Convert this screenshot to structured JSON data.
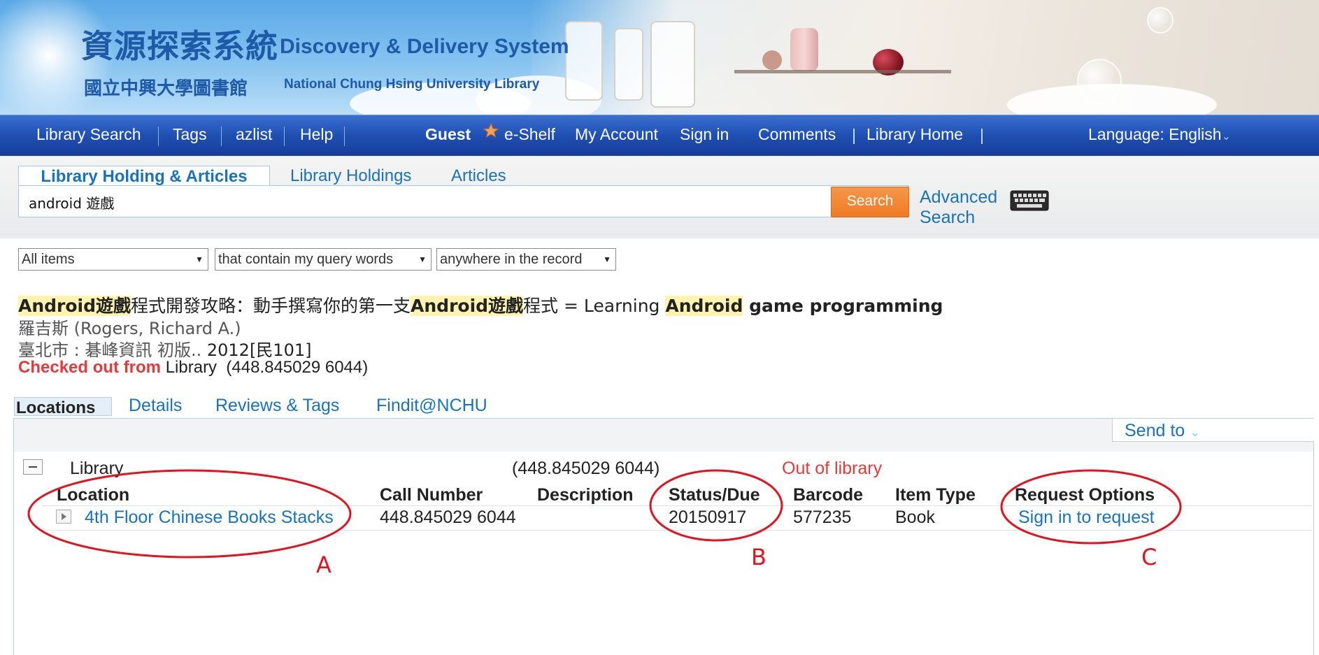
{
  "banner": {
    "title_zh": "資源探索系統",
    "title_en": "Discovery & Delivery System",
    "org_zh": "國立中興大學圖書館",
    "org_en": "National Chung Hsing University Library"
  },
  "nav": {
    "left": [
      "Library Search",
      "Tags",
      "azlist",
      "Help"
    ],
    "guest": "Guest",
    "eshelf": "e-Shelf",
    "my_account": "My Account",
    "sign_in": "Sign in",
    "comments": "Comments",
    "library_home": "Library Home",
    "language": "Language: English",
    "separator": "|"
  },
  "search": {
    "tabs": [
      "Library Holding & Articles",
      "Library Holdings",
      "Articles"
    ],
    "query": "android 遊戲",
    "button": "Search",
    "advanced_line1": "Advanced",
    "advanced_line2": "Search",
    "filters": [
      "All items",
      "that contain my query words",
      "anywhere in the record"
    ]
  },
  "result": {
    "title_parts": {
      "p1": "Android遊戲",
      "p2": "程式開發攻略：動手撰寫你的第一支",
      "p3": "Android遊戲",
      "p4": "程式 = Learning ",
      "p5": "Android",
      "p6": " game programming"
    },
    "author_zh": "羅吉斯",
    "author_en": " (Rogers, Richard A.)",
    "publisher": "臺北市 : 碁峰資訊 初版.. ",
    "year": "2012[民101]",
    "checked_out": "Checked out from",
    "location": " Library",
    "call_number": "(448.845029 6044)"
  },
  "detail_tabs": [
    "Locations",
    "Details",
    "Reviews & Tags",
    "Findit@NCHU"
  ],
  "panel": {
    "send_to": "Send to",
    "library": "Library",
    "call_number": "(448.845029 6044)",
    "availability": "Out of library",
    "headers": [
      "Location",
      "Call Number",
      "Description",
      "Status/Due",
      "Barcode",
      "Item Type",
      "Request Options"
    ],
    "row": {
      "location": "4th Floor Chinese Books Stacks",
      "call_number": "448.845029 6044",
      "description": "",
      "status_due": "20150917",
      "barcode": "577235",
      "item_type": "Book",
      "request": "Sign in to request"
    }
  },
  "annotations": [
    "A",
    "B",
    "C"
  ],
  "colors": {
    "link": "#1a73b8",
    "navbar": "#1f4fb2",
    "alert": "#e03c3c",
    "highlight": "#fff3b0",
    "search_button": "#ef7a22",
    "annotation": "#e0141e"
  }
}
